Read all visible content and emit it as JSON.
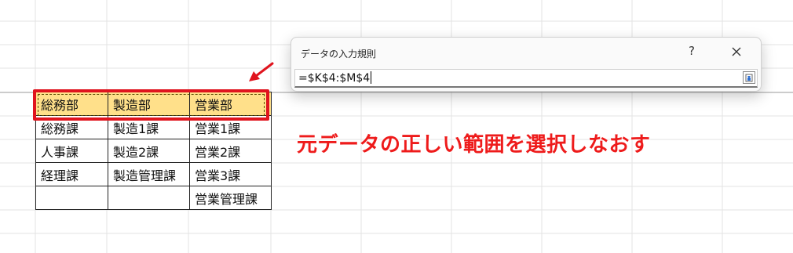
{
  "dialog": {
    "title": "データの入力規則",
    "help_label": "?",
    "source_value": "=$K$4:$M$4"
  },
  "table": {
    "header": [
      "総務部",
      "製造部",
      "営業部"
    ],
    "rows": [
      [
        "総務課",
        "製造1課",
        "営業1課"
      ],
      [
        "人事課",
        "製造2課",
        "営業2課"
      ],
      [
        "経理課",
        "製造管理課",
        "営業3課"
      ],
      [
        "",
        "",
        "営業管理課"
      ]
    ]
  },
  "annotation": {
    "text": "元データの正しい範囲を選択しなおす",
    "color": "#ee1b1b"
  },
  "colors": {
    "header_fill": "#ffe08a",
    "selection_border": "#e0141e"
  }
}
